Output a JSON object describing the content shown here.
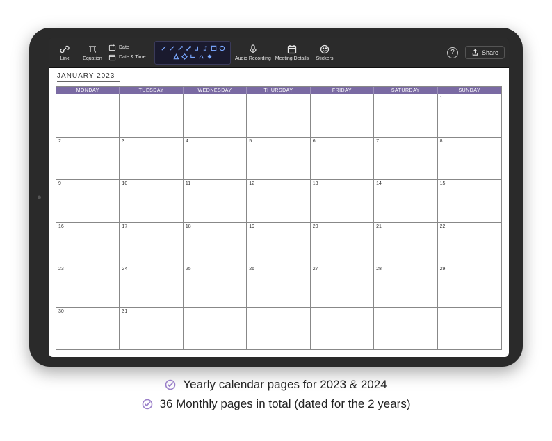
{
  "toolbar": {
    "link": "Link",
    "equation": "Equation",
    "date": "Date",
    "date_time": "Date & Time",
    "audio": "Audio Recording",
    "meeting": "Meeting Details",
    "stickers": "Stickers",
    "share": "Share",
    "help": "?"
  },
  "calendar": {
    "title": "JANUARY 2023",
    "accent": "#7a6aa3",
    "days": [
      "MONDAY",
      "TUESDAY",
      "WEDNESDAY",
      "THURSDAY",
      "FRIDAY",
      "SATURDAY",
      "SUNDAY"
    ],
    "cells": [
      "",
      "",
      "",
      "",
      "",
      "",
      "1",
      "2",
      "3",
      "4",
      "5",
      "6",
      "7",
      "8",
      "9",
      "10",
      "11",
      "12",
      "13",
      "14",
      "15",
      "16",
      "17",
      "18",
      "19",
      "20",
      "21",
      "22",
      "23",
      "24",
      "25",
      "26",
      "27",
      "28",
      "29",
      "30",
      "31",
      "",
      "",
      "",
      "",
      ""
    ]
  },
  "features": {
    "line1": "Yearly calendar pages for 2023 & 2024",
    "line2": "36 Monthly pages in total (dated for the 2 years)",
    "check_color": "#9a7fc9"
  }
}
